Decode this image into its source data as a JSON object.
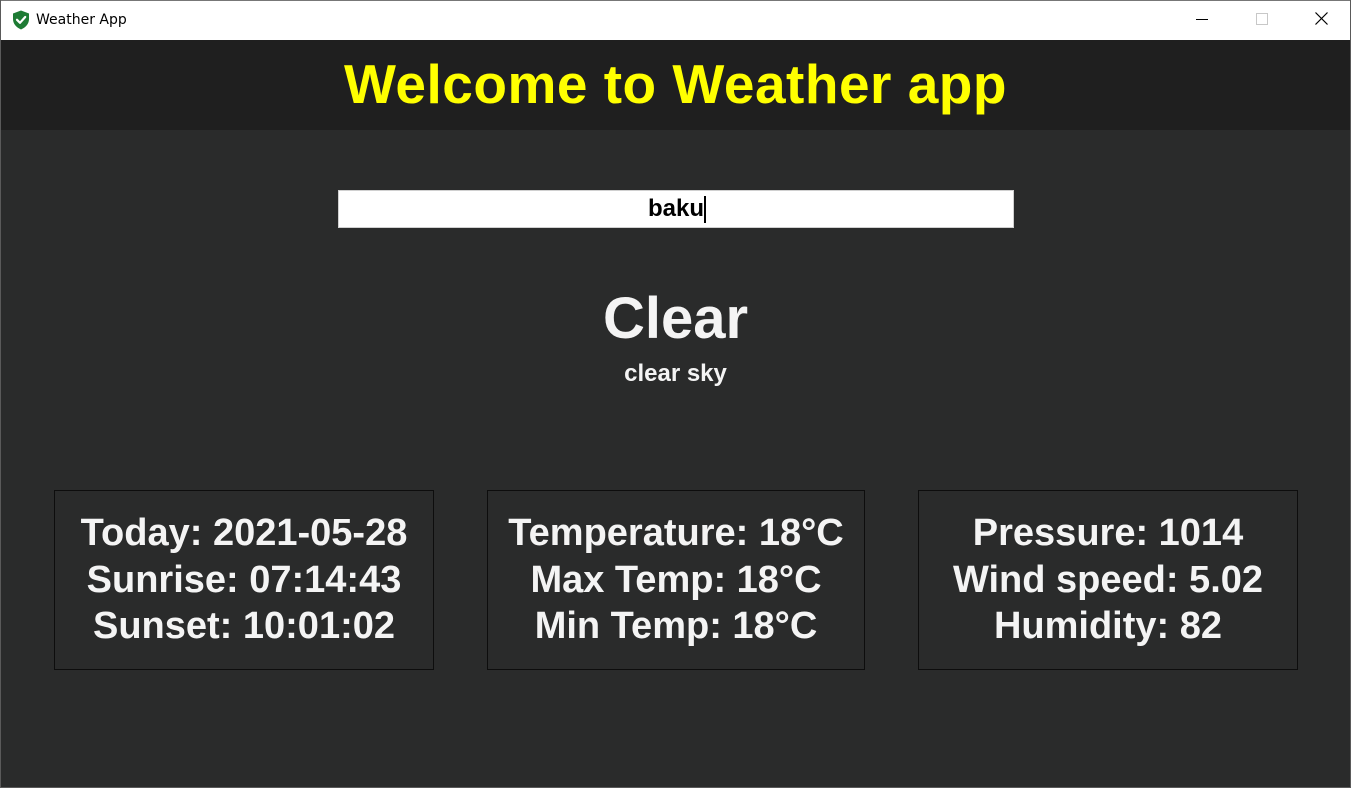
{
  "window": {
    "title": "Weather App",
    "icon": "shield-check-icon",
    "controls": {
      "minimize": "minimize-icon",
      "maximize": "maximize-icon",
      "close": "close-icon"
    }
  },
  "header": {
    "title": "Welcome to Weather app",
    "title_color": "#ffff00",
    "background": "#1f1f1f"
  },
  "search": {
    "value": "baku"
  },
  "weather": {
    "main": "Clear",
    "description": "clear sky"
  },
  "cards": {
    "date_sun": {
      "today": "Today: 2021-05-28",
      "sunrise": "Sunrise: 07:14:43",
      "sunset": "Sunset: 10:01:02"
    },
    "temperature": {
      "current": "Temperature: 18°C",
      "max": "Max Temp: 18°C",
      "min": "Min Temp: 18°C"
    },
    "atmosphere": {
      "pressure": "Pressure: 1014",
      "wind_speed": "Wind speed: 5.02",
      "humidity": "Humidity: 82"
    }
  },
  "colors": {
    "background": "#2a2b2b",
    "text": "#f4f4f4",
    "accent": "#ffff00"
  }
}
